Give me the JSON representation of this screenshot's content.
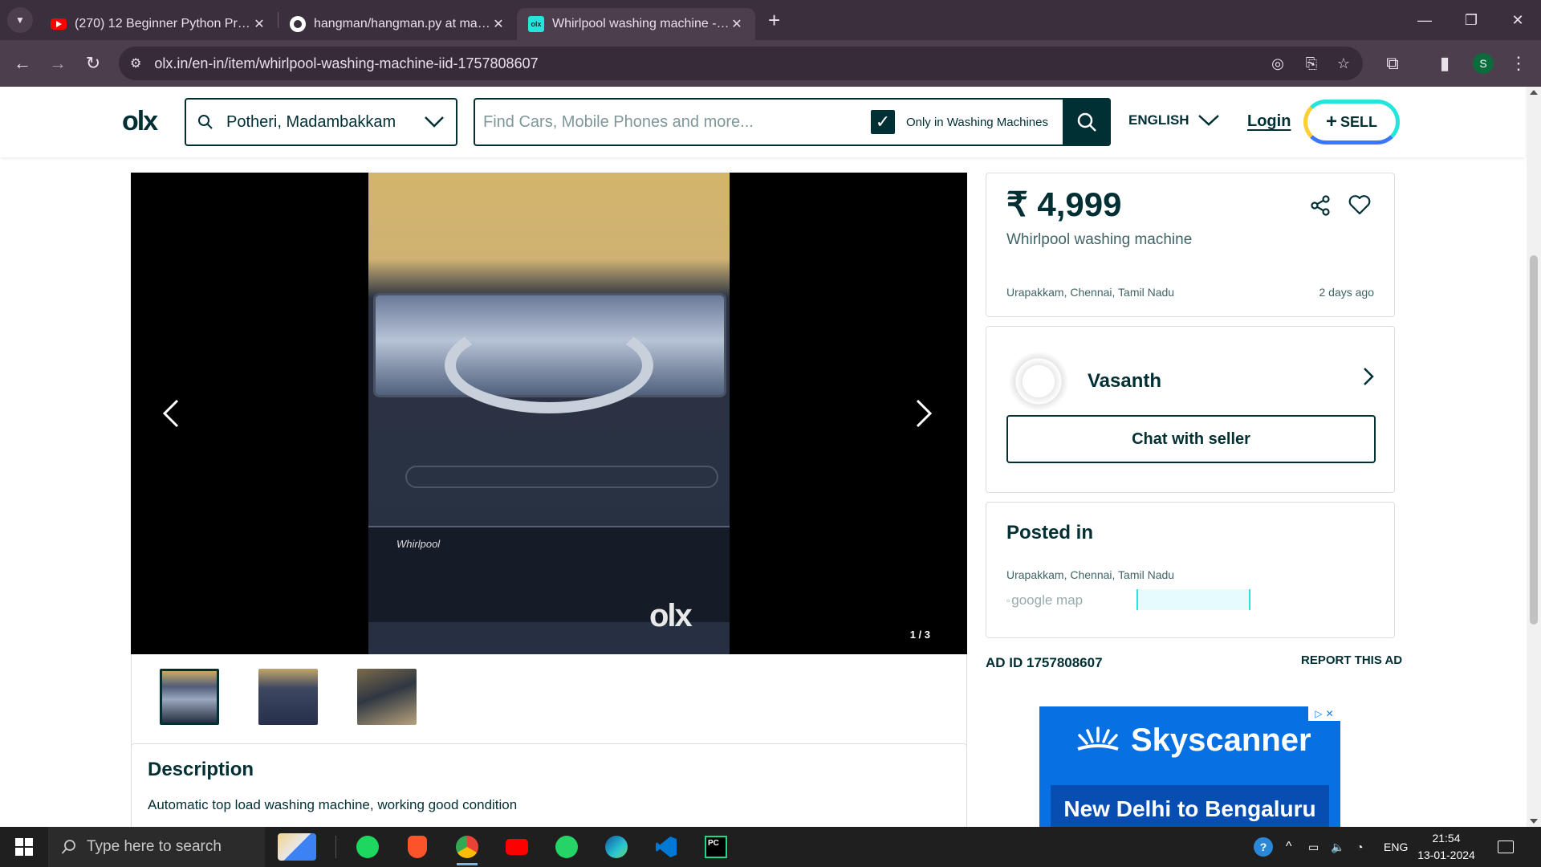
{
  "browser": {
    "tabs": [
      {
        "title": "(270) 12 Beginner Python Projects - Coding Course",
        "favicon": "youtube-icon"
      },
      {
        "title": "hangman/hangman.py at master",
        "favicon": "github-icon"
      },
      {
        "title": "Whirlpool washing machine - Washing Machines",
        "favicon": "olx-icon",
        "active": true
      }
    ],
    "url": "olx.in/en-in/item/whirlpool-washing-machine-iid-1757808607",
    "profile_initial": "S"
  },
  "header": {
    "logo": "olx",
    "location": "Potheri, Madambakkam",
    "search_placeholder": "Find Cars, Mobile Phones and more...",
    "category_filter": "Only in Washing Machines",
    "language": "ENGLISH",
    "login": "Login",
    "sell": "SELL"
  },
  "gallery": {
    "counter": "1 / 3",
    "watermark": "olx",
    "brand_print": "Whirlpool"
  },
  "listing": {
    "price": "₹ 4,999",
    "title": "Whirlpool washing machine",
    "location": "Urapakkam, Chennai, Tamil Nadu",
    "posted": "2 days ago"
  },
  "seller": {
    "name": "Vasanth",
    "chat_button": "Chat with seller"
  },
  "posted_in": {
    "heading": "Posted in",
    "location": "Urapakkam, Chennai, Tamil Nadu",
    "map_alt": "google map"
  },
  "ad_meta": {
    "ad_id": "AD ID 1757808607",
    "report": "REPORT THIS AD"
  },
  "advert": {
    "brand": "Skyscanner",
    "route": "New Delhi to Bengaluru"
  },
  "description": {
    "heading": "Description",
    "text": "Automatic top load washing machine, working good condition"
  },
  "taskbar": {
    "search_placeholder": "Type here to search",
    "language": "ENG",
    "time": "21:54",
    "date": "13-01-2024"
  }
}
